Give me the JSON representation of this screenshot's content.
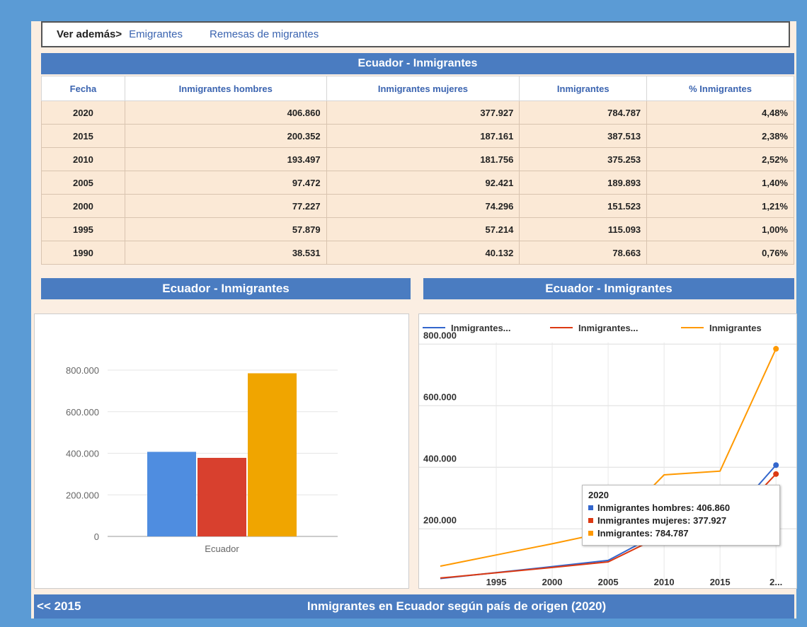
{
  "see_also": {
    "lead": "Ver además>",
    "links": [
      "Emigrantes",
      "Remesas de migrantes"
    ]
  },
  "table": {
    "title": "Ecuador - Inmigrantes",
    "headers": [
      "Fecha",
      "Inmigrantes hombres",
      "Inmigrantes mujeres",
      "Inmigrantes",
      "% Inmigrantes"
    ],
    "rows": [
      [
        "2020",
        "406.860",
        "377.927",
        "784.787",
        "4,48%"
      ],
      [
        "2015",
        "200.352",
        "187.161",
        "387.513",
        "2,38%"
      ],
      [
        "2010",
        "193.497",
        "181.756",
        "375.253",
        "2,52%"
      ],
      [
        "2005",
        "97.472",
        "92.421",
        "189.893",
        "1,40%"
      ],
      [
        "2000",
        "77.227",
        "74.296",
        "151.523",
        "1,21%"
      ],
      [
        "1995",
        "57.879",
        "57.214",
        "115.093",
        "1,00%"
      ],
      [
        "1990",
        "38.531",
        "40.132",
        "78.663",
        "0,76%"
      ]
    ]
  },
  "colors": {
    "hombres": "#4f8de0",
    "mujeres": "#d8402e",
    "total": "#f0a500",
    "header_bar": "#4a7cc1"
  },
  "chart_data": [
    {
      "type": "bar",
      "title": "Ecuador - Inmigrantes",
      "categories": [
        "Ecuador"
      ],
      "series": [
        {
          "values": [
            406860
          ]
        },
        {
          "values": [
            377927
          ]
        },
        {
          "values": [
            784787
          ]
        }
      ],
      "yticks": [
        "0",
        "200.000",
        "400.000",
        "600.000",
        "800.000"
      ],
      "ylim": [
        0,
        800000
      ]
    },
    {
      "type": "line",
      "title": "Ecuador - Inmigrantes",
      "legend": [
        "Inmigrantes...",
        "Inmigrantes...",
        "Inmigrantes"
      ],
      "x": [
        1990,
        1995,
        2000,
        2005,
        2010,
        2015,
        2020
      ],
      "xticks": [
        "1995",
        "2000",
        "2005",
        "2010",
        "2015",
        "2..."
      ],
      "yticks": [
        "200.000",
        "400.000",
        "600.000",
        "800.000"
      ],
      "series": [
        {
          "name": "Inmigrantes hombres",
          "values": [
            38531,
            57879,
            77227,
            97472,
            193497,
            200352,
            406860
          ]
        },
        {
          "name": "Inmigrantes mujeres",
          "values": [
            40132,
            57214,
            74296,
            92421,
            181756,
            187161,
            377927
          ]
        },
        {
          "name": "Inmigrantes",
          "values": [
            78663,
            115093,
            151523,
            189893,
            375253,
            387513,
            784787
          ]
        }
      ],
      "tooltip": {
        "title": "2020",
        "lines": [
          "Inmigrantes hombres: 406.860",
          "Inmigrantes mujeres: 377.927",
          "Inmigrantes: 784.787"
        ]
      }
    }
  ],
  "footer": {
    "prev": "<< 2015",
    "title": "Inmigrantes en Ecuador según país de origen (2020)"
  }
}
